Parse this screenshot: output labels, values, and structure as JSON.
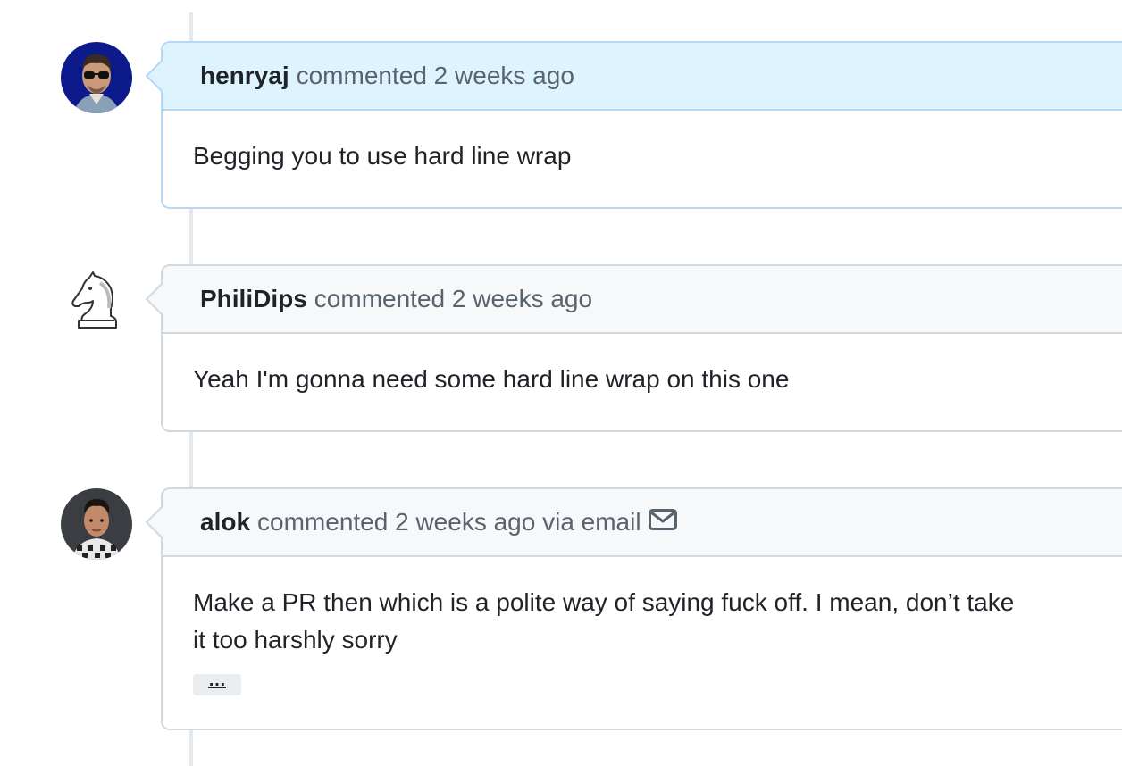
{
  "comments": [
    {
      "author": "henryaj",
      "meta": "commented 2 weeks ago",
      "body": "Begging you to use hard line wrap",
      "avatar_icon": "avatar-photo-sunglasses"
    },
    {
      "author": "PhiliDips",
      "meta": "commented 2 weeks ago",
      "body": "Yeah I'm gonna need some hard line wrap on this one",
      "avatar_icon": "chess-knight-icon"
    },
    {
      "author": "alok",
      "meta": "commented 2 weeks ago via email",
      "body_line1": "Make a PR then which is a polite way of saying fuck off. I mean, don’t take",
      "body_line2": "it too harshly sorry",
      "ellipsis": "…",
      "via_icon": "mail-icon",
      "avatar_icon": "avatar-photo-portrait"
    }
  ]
}
